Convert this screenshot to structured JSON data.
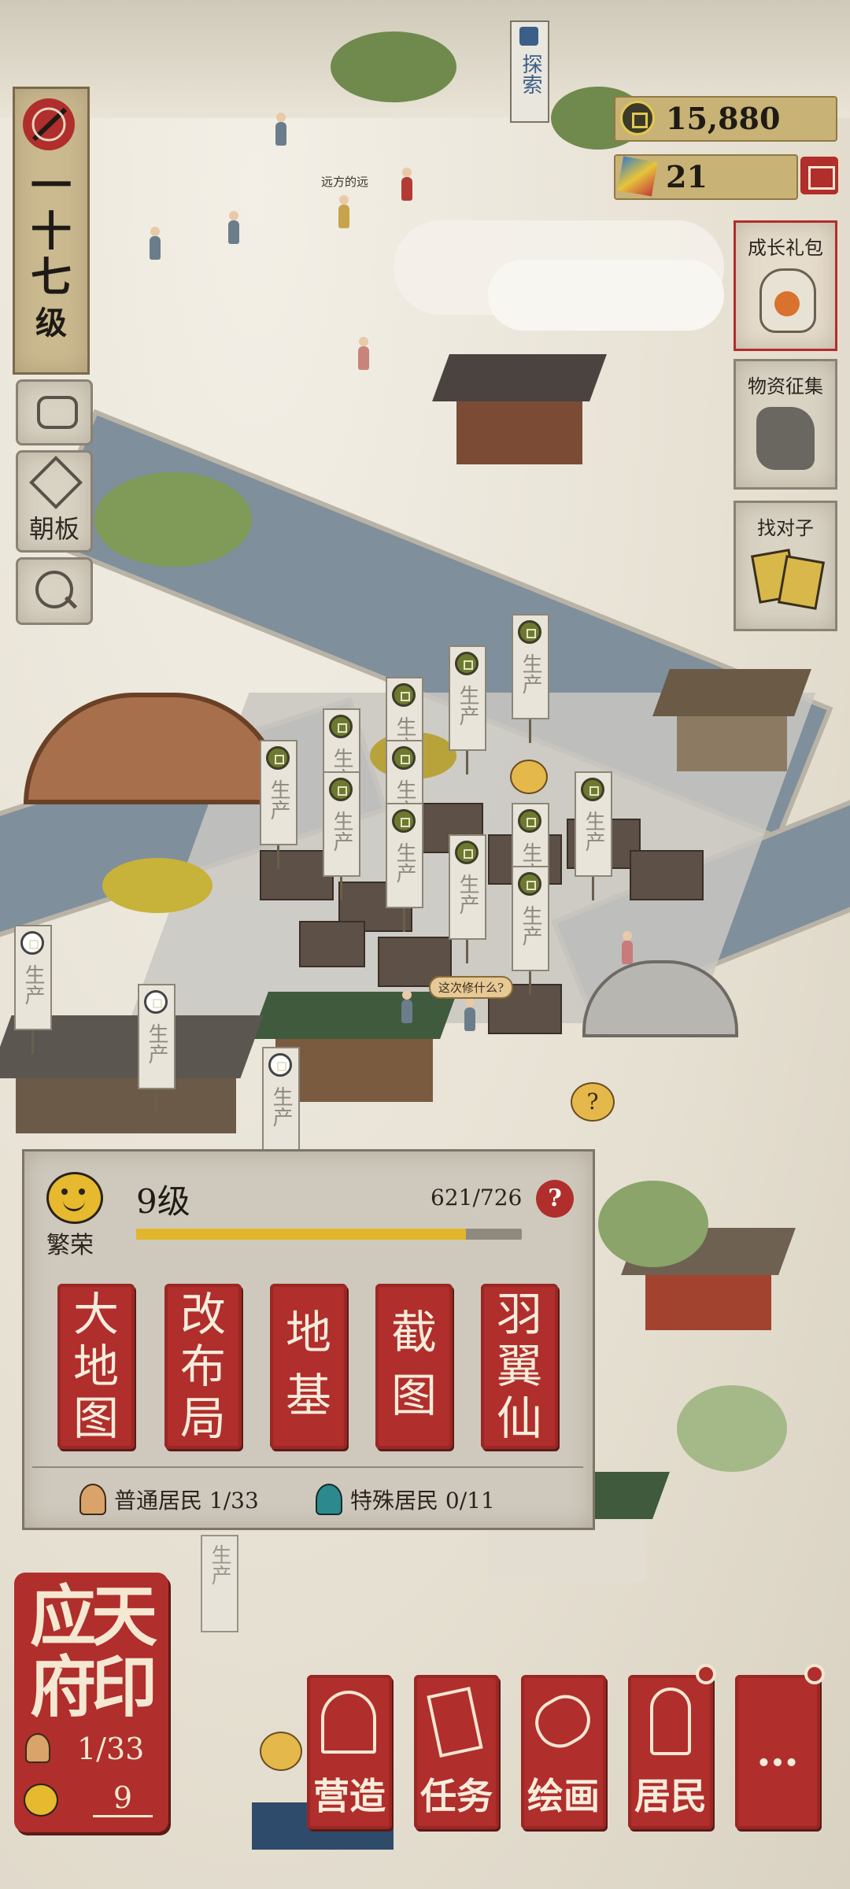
{
  "level_panel": {
    "line1": "一",
    "line2": "十",
    "line3": "七",
    "line4": "级"
  },
  "left_menu": {
    "chat_icon": "chat-bubble-icon",
    "court_label": "朝板",
    "search_icon": "search-building-icon"
  },
  "explore_flag": {
    "label": "探索"
  },
  "currency": {
    "coins": "15,880",
    "gems": "21"
  },
  "right_menu": {
    "growth_pack": "成长礼包",
    "materials": "物资征集",
    "match_pairs": "找对子"
  },
  "map_labels": {
    "name_tag": "远方的远",
    "speech_repair": "这次修什么?",
    "production_banner": "生产"
  },
  "prosperity": {
    "icon": "smiley-face-icon",
    "label": "繁荣",
    "level": "9级",
    "progress_text": "621/726",
    "progress": 0.855,
    "help": "?",
    "buttons": [
      {
        "l1": "大",
        "l2": "地",
        "l3": "图"
      },
      {
        "l1": "改",
        "l2": "布",
        "l3": "局"
      },
      {
        "l1": "地",
        "l2": "基"
      },
      {
        "l1": "截",
        "l2": "图"
      },
      {
        "l1": "羽",
        "l2": "翼",
        "l3": "仙"
      }
    ],
    "common_residents": "普通居民 1/33",
    "special_residents": "特殊居民 0/11"
  },
  "city_seal": {
    "line1": "应天",
    "line2": "府印",
    "residents": "1/33",
    "prosperity": "9"
  },
  "bottom_nav": [
    {
      "label": "营造",
      "icon": "pavilion-icon"
    },
    {
      "label": "任务",
      "icon": "book-icon"
    },
    {
      "label": "绘画",
      "icon": "scroll-icon"
    },
    {
      "label": "居民",
      "icon": "resident-icon"
    },
    {
      "label": "…",
      "icon": "more-icon"
    }
  ],
  "colors": {
    "accent_red": "#b02e2b",
    "paper": "#d9d3c4",
    "gold": "#e2b62a"
  }
}
